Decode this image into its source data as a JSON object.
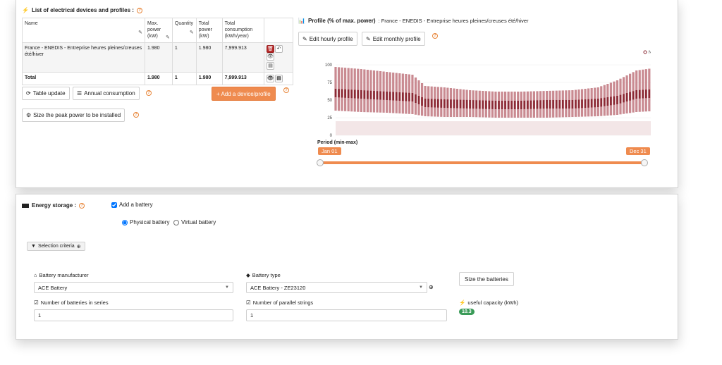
{
  "devices_section": {
    "title": "List of electrical devices and profiles :",
    "columns": [
      "Name",
      "Max. power (kW)",
      "Quantity",
      "Total power (kW)",
      "Total consumption (kWh/year)"
    ],
    "rows": [
      {
        "name": "France - ENEDIS - Entreprise heures pleines/creuses été/hiver",
        "max_power": "1.980",
        "quantity": "1",
        "total_power": "1.980",
        "consumption": "7,999.913"
      }
    ],
    "total": {
      "label": "Total",
      "max_power": "1.980",
      "quantity": "1",
      "total_power": "1.980",
      "consumption": "7,999.913"
    },
    "buttons": {
      "table_update": "Table update",
      "annual_consumption": "Annual consumption",
      "add_device": "+ Add a device/profile",
      "size_peak": "Size the peak power to be installed"
    }
  },
  "profile_section": {
    "title": "Profile (% of max. power)",
    "subtitle": ": France - ENEDIS - Entreprise heures pleines/creuses été/hiver",
    "edit_hourly": "Edit hourly profile",
    "edit_monthly": "Edit monthly profile",
    "period_label": "Period (min-max)",
    "period_start": "Jan 01",
    "period_end": "Dec 31",
    "range": {
      "start_fraction": 0,
      "end_fraction": 1
    }
  },
  "chart_data": {
    "type": "area",
    "title": "",
    "legend": [
      "Needs"
    ],
    "legend_position": "top-right",
    "ylim": [
      0,
      100
    ],
    "yticks": [
      "100",
      "75",
      "50",
      "25",
      "0"
    ],
    "series": [
      {
        "name": "Needs",
        "color": "#8b2a35",
        "x_weeks": [
          1,
          5,
          9,
          13,
          15,
          18,
          22,
          26,
          30,
          34,
          38,
          42,
          45,
          48,
          52
        ],
        "max": [
          97,
          94,
          90,
          86,
          70,
          68,
          64,
          62,
          62,
          63,
          64,
          68,
          78,
          92,
          97
        ],
        "mean": [
          60,
          58,
          56,
          54,
          46,
          45,
          44,
          43,
          43,
          44,
          44,
          46,
          50,
          58,
          60
        ],
        "min": [
          35,
          33,
          32,
          30,
          27,
          26,
          26,
          25,
          25,
          25,
          26,
          27,
          29,
          33,
          35
        ]
      }
    ]
  },
  "storage_section": {
    "title": "Energy storage :",
    "add_battery_label": "Add a battery",
    "add_battery_checked": true,
    "physical_label": "Physical battery",
    "virtual_label": "Virtual battery",
    "selection_criteria": "Selection criteria",
    "manufacturer_label": "Battery manufacturer",
    "manufacturer_value": "ACE Battery",
    "type_label": "Battery type",
    "type_value": "ACE Battery - ZE23120",
    "size_batteries": "Size the batteries",
    "series_label": "Number of batteries in series",
    "series_value": "1",
    "parallel_label": "Number of parallel strings",
    "parallel_value": "1",
    "capacity_label": "useful capacity (kWh)",
    "capacity_value": "10.3"
  },
  "colors": {
    "accent": "#ef8b4f",
    "series": "#8b2a35",
    "success": "#3a9b58",
    "danger": "#b52a2a"
  }
}
